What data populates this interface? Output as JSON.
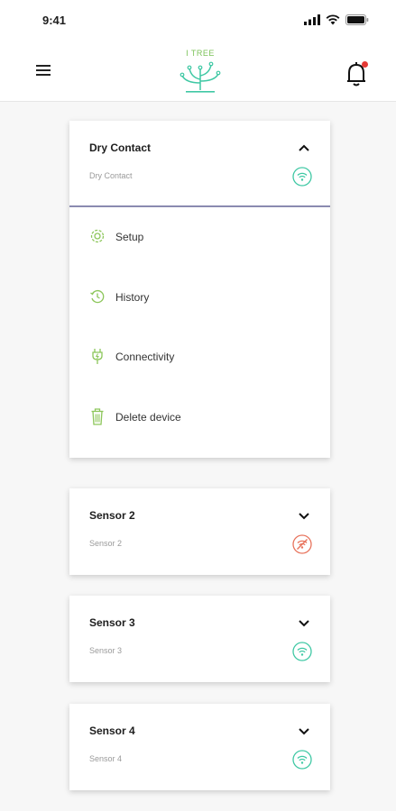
{
  "status_bar": {
    "time": "9:41"
  },
  "header": {
    "logo_text": "I TREE"
  },
  "expanded_device": {
    "title": "Dry Contact",
    "subtitle": "Dry Contact",
    "connection": "online",
    "menu": [
      {
        "label": "Setup",
        "icon": "gear-icon"
      },
      {
        "label": "History",
        "icon": "history-icon"
      },
      {
        "label": "Connectivity",
        "icon": "plug-icon"
      },
      {
        "label": "Delete device",
        "icon": "trash-icon"
      }
    ]
  },
  "devices": [
    {
      "title": "Sensor 2",
      "subtitle": "Sensor 2",
      "connection": "offline"
    },
    {
      "title": "Sensor 3",
      "subtitle": "Sensor 3",
      "connection": "online"
    },
    {
      "title": "Sensor 4",
      "subtitle": "Sensor 4",
      "connection": "online"
    }
  ],
  "colors": {
    "online": "#3fc8a4",
    "offline": "#e8735c",
    "accent_green": "#8cc65a",
    "divider": "#8a8ab0",
    "notification_dot": "#e53935"
  }
}
